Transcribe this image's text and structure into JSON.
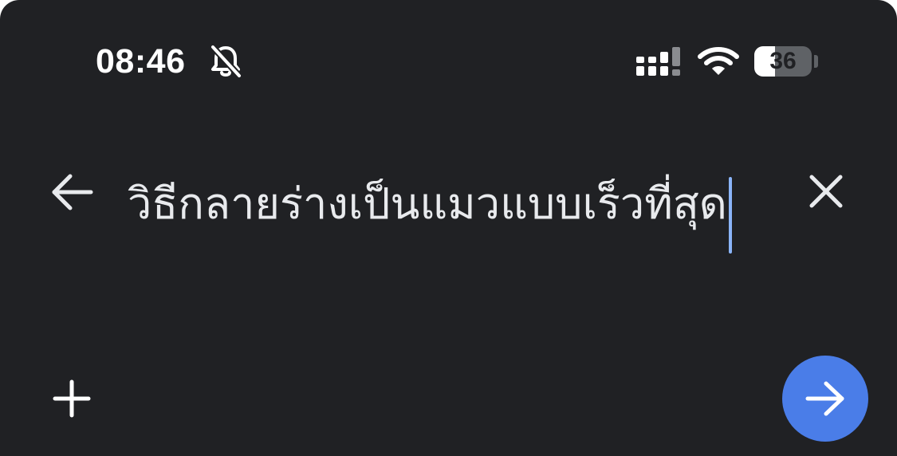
{
  "status_bar": {
    "time": "08:46",
    "battery_level": "36",
    "battery_fraction": 0.36,
    "icons": [
      "bell-slash-icon",
      "cellular-signal-icon",
      "wifi-icon",
      "battery-icon"
    ]
  },
  "search": {
    "query": "วิธีกลายร่างเป็นแมวแบบเร็วที่สุด"
  },
  "toolbar": {
    "icons": [
      "back-arrow-icon",
      "close-icon",
      "plus-icon",
      "send-arrow-icon"
    ]
  },
  "colors": {
    "background": "#202124",
    "text": "#e8eaed",
    "accent": "#4a7de8",
    "caret": "#8ab4f8"
  }
}
